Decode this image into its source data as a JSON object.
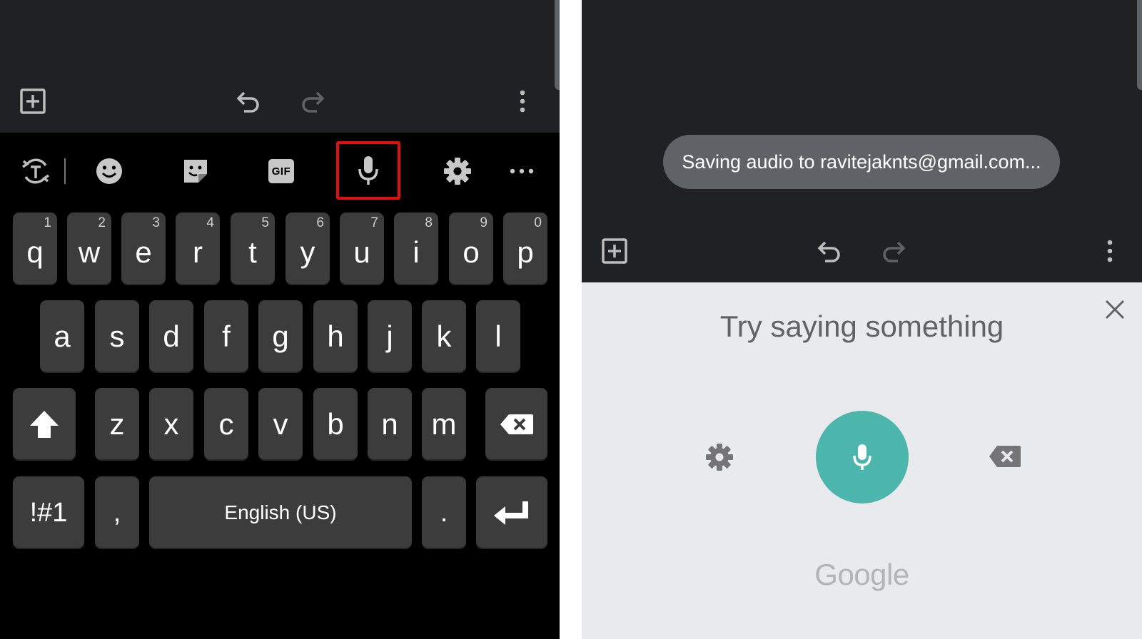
{
  "left_panel": {
    "toolbar": {
      "add_icon": "add-box-icon",
      "undo_icon": "undo-icon",
      "redo_icon": "redo-icon",
      "menu_icon": "more-vert-icon"
    },
    "keyboard_tools": {
      "translate_icon": "translate-icon",
      "emoji_icon": "emoji-icon",
      "sticker_icon": "sticker-icon",
      "gif_label": "GIF",
      "mic_icon": "mic-icon",
      "settings_icon": "settings-icon",
      "more_icon": "more-horiz-icon",
      "highlight_color": "#e01010"
    },
    "keyboard": {
      "row1": [
        {
          "ch": "q",
          "num": "1"
        },
        {
          "ch": "w",
          "num": "2"
        },
        {
          "ch": "e",
          "num": "3"
        },
        {
          "ch": "r",
          "num": "4"
        },
        {
          "ch": "t",
          "num": "5"
        },
        {
          "ch": "y",
          "num": "6"
        },
        {
          "ch": "u",
          "num": "7"
        },
        {
          "ch": "i",
          "num": "8"
        },
        {
          "ch": "o",
          "num": "9"
        },
        {
          "ch": "p",
          "num": "0"
        }
      ],
      "row2": [
        "a",
        "s",
        "d",
        "f",
        "g",
        "h",
        "j",
        "k",
        "l"
      ],
      "row3": [
        "z",
        "x",
        "c",
        "v",
        "b",
        "n",
        "m"
      ],
      "symbols_key": "!#1",
      "comma_key": ",",
      "space_key": "English (US)",
      "period_key": ".",
      "shift_icon": "shift-icon",
      "backspace_icon": "backspace-icon",
      "enter_icon": "enter-icon"
    }
  },
  "right_panel": {
    "toast": "Saving audio to ravitejaknts@gmail.com...",
    "toolbar": {
      "add_icon": "add-box-icon",
      "undo_icon": "undo-icon",
      "redo_icon": "redo-icon",
      "menu_icon": "more-vert-icon"
    },
    "voice": {
      "prompt": "Try saying something",
      "brand": "Google",
      "close_icon": "close-icon",
      "settings_icon": "settings-icon",
      "mic_icon": "mic-icon",
      "delete_icon": "backspace-icon",
      "mic_color": "#4db6ac"
    }
  }
}
